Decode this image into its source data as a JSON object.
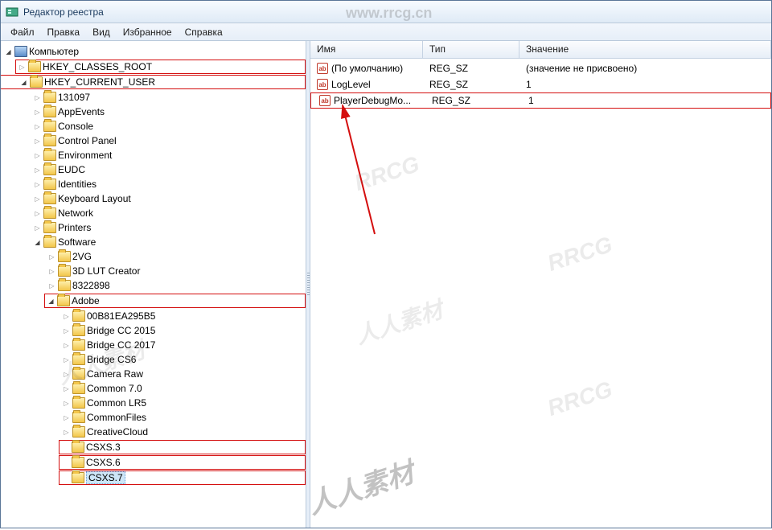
{
  "window": {
    "title": "Редактор реестра"
  },
  "menu": {
    "file": "Файл",
    "edit": "Правка",
    "view": "Вид",
    "favorites": "Избранное",
    "help": "Справка"
  },
  "list_header": {
    "name": "Имя",
    "type": "Тип",
    "value": "Значение"
  },
  "values": [
    {
      "name": "(По умолчанию)",
      "type": "REG_SZ",
      "value": "(значение не присвоено)",
      "hl": false
    },
    {
      "name": "LogLevel",
      "type": "REG_SZ",
      "value": "1",
      "hl": false
    },
    {
      "name": "PlayerDebugMo...",
      "type": "REG_SZ",
      "value": "1",
      "hl": true
    }
  ],
  "tree": {
    "root": "Компьютер",
    "hkcr": "HKEY_CLASSES_ROOT",
    "hkcu": "HKEY_CURRENT_USER",
    "hkcu_children": [
      "131097",
      "AppEvents",
      "Console",
      "Control Panel",
      "Environment",
      "EUDC",
      "Identities",
      "Keyboard Layout",
      "Network",
      "Printers"
    ],
    "software": "Software",
    "software_children": [
      "2VG",
      "3D LUT Creator",
      "8322898"
    ],
    "adobe": "Adobe",
    "adobe_children": [
      "00B81EA295B5",
      "Bridge CC 2015",
      "Bridge CC 2017",
      "Bridge CS6",
      "Camera Raw",
      "Common 7.0",
      "Common LR5",
      "CommonFiles",
      "CreativeCloud"
    ],
    "csxs3": "CSXS.3",
    "csxs6": "CSXS.6",
    "csxs7": "CSXS.7"
  }
}
